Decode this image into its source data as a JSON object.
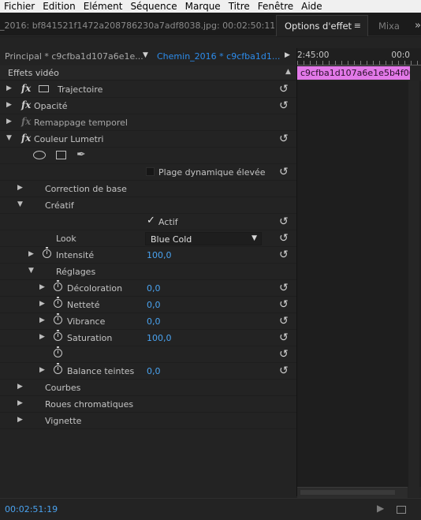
{
  "menu": [
    "Fichier",
    "Edition",
    "Elément",
    "Séquence",
    "Marque",
    "Titre",
    "Fenêtre",
    "Aide"
  ],
  "tabs": {
    "source_path": "_2016: bf841521f1472a208786230a7adf8038.jpg: 00:02:50:11",
    "active": "Options d'effet",
    "active_menu": "≡",
    "next": "Mixa",
    "overflow": "»"
  },
  "sequence": {
    "master": "Principal * c9cfba1d107a6e1e...",
    "clip": "Chemin_2016 * c9cfba1d1...",
    "dropdown_arrow": "▼",
    "play_arrow": "▶"
  },
  "ruler": {
    "start": "2:45:00",
    "end": "00:0"
  },
  "timeline_clip": "c9cfba1d107a6e1e5b4f069",
  "section": {
    "label": "Effets vidéo",
    "collapse": "▲"
  },
  "effects": {
    "trajectoire": "Trajectoire",
    "opacite": "Opacité",
    "remappage": "Remappage temporel",
    "lumetri": "Couleur Lumetri",
    "plage": "Plage dynamique élevée",
    "correction": "Correction de base",
    "creatif": "Créatif",
    "actif": "Actif",
    "look_label": "Look",
    "look_value": "Blue Cold",
    "intensite": "Intensité",
    "intensite_value": "100,0",
    "reglages": "Réglages",
    "decoloration": "Décoloration",
    "decoloration_value": "0,0",
    "nettete": "Netteté",
    "nettete_value": "0,0",
    "vibrance": "Vibrance",
    "vibrance_value": "0,0",
    "saturation": "Saturation",
    "saturation_value": "100,0",
    "balance": "Balance teintes",
    "balance_value": "0,0",
    "courbes": "Courbes",
    "roues": "Roues chromatiques",
    "vignette": "Vignette"
  },
  "glyphs": {
    "fx": "fx",
    "reset": "↺",
    "tw_right": "▶",
    "tw_down": "▼",
    "check": "✓",
    "pen": "✒"
  },
  "footer": {
    "timecode": "00:02:51:19"
  }
}
